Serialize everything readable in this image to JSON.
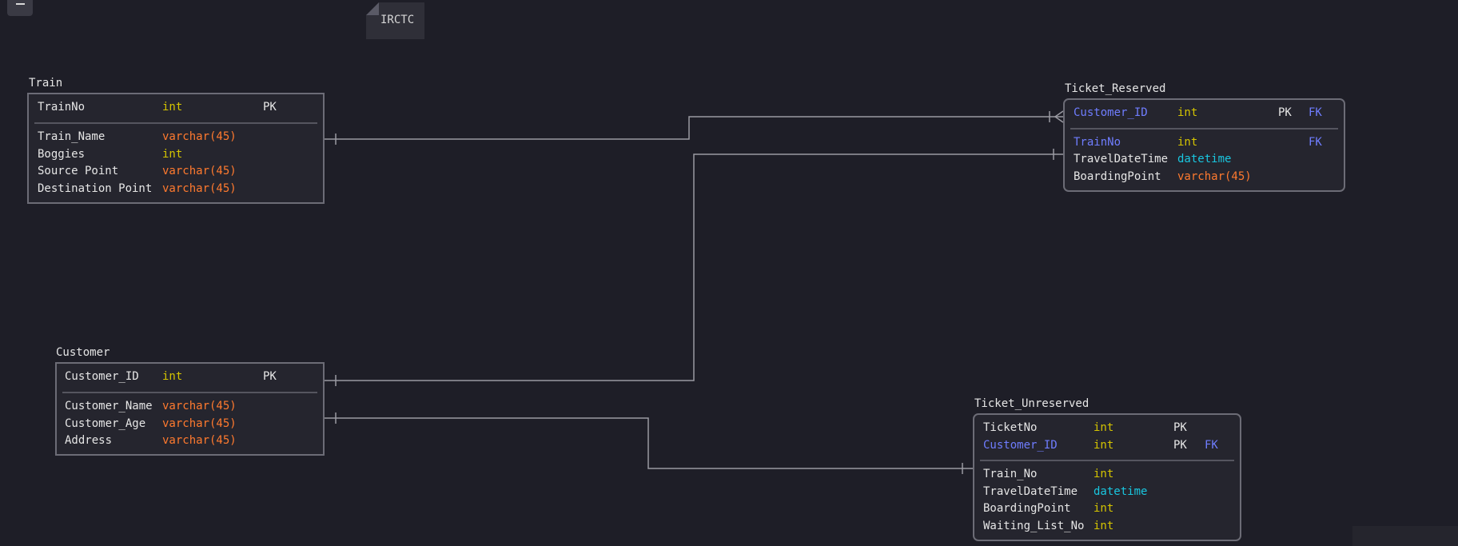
{
  "note": {
    "text": "IRCTC"
  },
  "tables": {
    "train": {
      "title": "Train",
      "key_rows": [
        {
          "name": "TrainNo",
          "type": "int",
          "pk": "PK",
          "fk": ""
        }
      ],
      "rows": [
        {
          "name": "Train_Name",
          "type": "varchar(45)"
        },
        {
          "name": "Boggies",
          "type": "int"
        },
        {
          "name": "Source Point",
          "type": "varchar(45)"
        },
        {
          "name": "Destination Point",
          "type": "varchar(45)"
        }
      ]
    },
    "customer": {
      "title": "Customer",
      "key_rows": [
        {
          "name": "Customer_ID",
          "type": "int",
          "pk": "PK",
          "fk": ""
        }
      ],
      "rows": [
        {
          "name": "Customer_Name",
          "type": "varchar(45)"
        },
        {
          "name": "Customer_Age",
          "type": "varchar(45)"
        },
        {
          "name": "Address",
          "type": "varchar(45)"
        }
      ]
    },
    "ticket_reserved": {
      "title": "Ticket_Reserved",
      "key_rows": [
        {
          "name": "Customer_ID",
          "type": "int",
          "pk": "PK",
          "fk": "FK"
        }
      ],
      "rows": [
        {
          "name": "TrainNo",
          "type": "int",
          "fk": "FK"
        },
        {
          "name": "TravelDateTime",
          "type": "datetime"
        },
        {
          "name": "BoardingPoint",
          "type": "varchar(45)"
        }
      ]
    },
    "ticket_unreserved": {
      "title": "Ticket_Unreserved",
      "key_rows": [
        {
          "name": "TicketNo",
          "type": "int",
          "pk": "PK",
          "fk": ""
        },
        {
          "name": "Customer_ID",
          "type": "int",
          "pk": "PK",
          "fk": "FK"
        }
      ],
      "rows": [
        {
          "name": "Train_No",
          "type": "int"
        },
        {
          "name": "TravelDateTime",
          "type": "datetime"
        },
        {
          "name": "BoardingPoint",
          "type": "int"
        },
        {
          "name": "Waiting_List_No",
          "type": "int"
        }
      ]
    }
  },
  "colors": {
    "background": "#1e1e27",
    "table_border": "#6c6c76",
    "connector": "#9a9aa2",
    "int": "#d4c400",
    "varchar": "#ff7a2e",
    "datetime": "#19c6df",
    "foreign_key": "#6f7dff"
  },
  "relationships": [
    {
      "from": "Train.TrainNo",
      "to": "Ticket_Reserved.Customer_ID",
      "from_end": "one",
      "to_end": "many"
    },
    {
      "from": "Customer.Customer_ID",
      "to": "Ticket_Reserved.TrainNo",
      "from_end": "one",
      "to_end": "one"
    },
    {
      "from": "Customer.Customer_ID",
      "to": "Ticket_Unreserved.Customer_ID",
      "from_end": "one",
      "to_end": "one"
    }
  ]
}
